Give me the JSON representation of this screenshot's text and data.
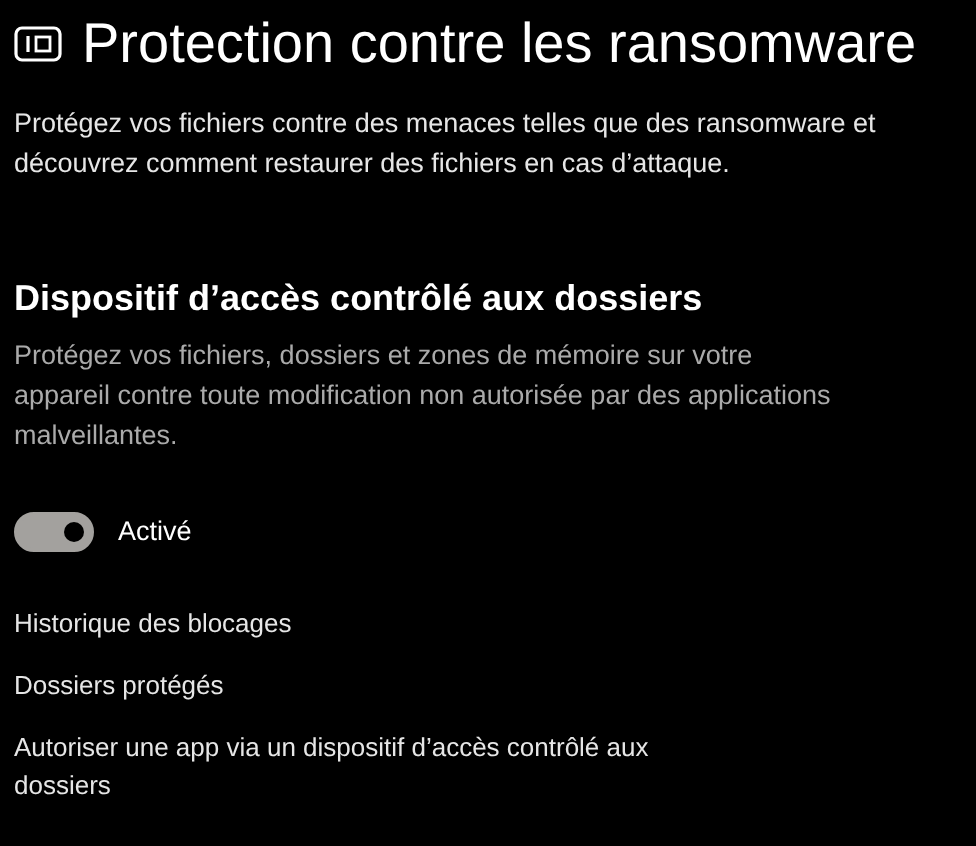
{
  "header": {
    "title": "Protection contre les ransomware",
    "description": "Protégez vos fichiers contre des menaces telles que des ransomware et découvrez comment restaurer des fichiers en cas d’attaque."
  },
  "section": {
    "title": "Dispositif d’accès contrôlé aux dossiers",
    "description": "Protégez vos fichiers, dossiers et zones de mémoire sur votre appareil contre toute modification non autorisée par des applications malveillantes.",
    "toggle": {
      "label": "Activé",
      "on": true,
      "disabled": true
    }
  },
  "links": [
    "Historique des blocages",
    "Dossiers protégés",
    "Autoriser une app via un dispositif d’accès contrôlé aux dossiers"
  ]
}
